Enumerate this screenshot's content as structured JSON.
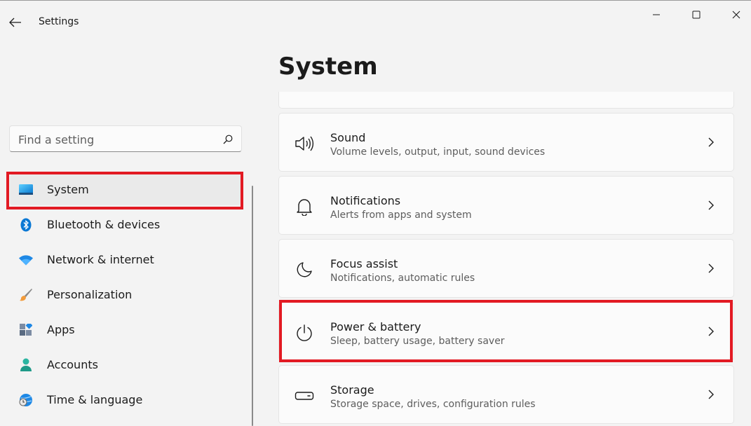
{
  "window": {
    "title": "Settings"
  },
  "search": {
    "placeholder": "Find a setting"
  },
  "sidebar": {
    "items": [
      {
        "label": "System",
        "icon": "system-icon"
      },
      {
        "label": "Bluetooth & devices",
        "icon": "bluetooth-icon"
      },
      {
        "label": "Network & internet",
        "icon": "wifi-icon"
      },
      {
        "label": "Personalization",
        "icon": "brush-icon"
      },
      {
        "label": "Apps",
        "icon": "apps-icon"
      },
      {
        "label": "Accounts",
        "icon": "accounts-icon"
      },
      {
        "label": "Time & language",
        "icon": "time-language-icon"
      }
    ]
  },
  "main": {
    "title": "System",
    "cards": [
      {
        "title": "Sound",
        "subtitle": "Volume levels, output, input, sound devices",
        "icon": "speaker-icon"
      },
      {
        "title": "Notifications",
        "subtitle": "Alerts from apps and system",
        "icon": "bell-icon"
      },
      {
        "title": "Focus assist",
        "subtitle": "Notifications, automatic rules",
        "icon": "moon-icon"
      },
      {
        "title": "Power & battery",
        "subtitle": "Sleep, battery usage, battery saver",
        "icon": "power-icon"
      },
      {
        "title": "Storage",
        "subtitle": "Storage space, drives, configuration rules",
        "icon": "storage-icon"
      }
    ]
  },
  "colors": {
    "highlight": "#e21a23",
    "accent": "#0067c0",
    "background": "#f3f3f3"
  }
}
